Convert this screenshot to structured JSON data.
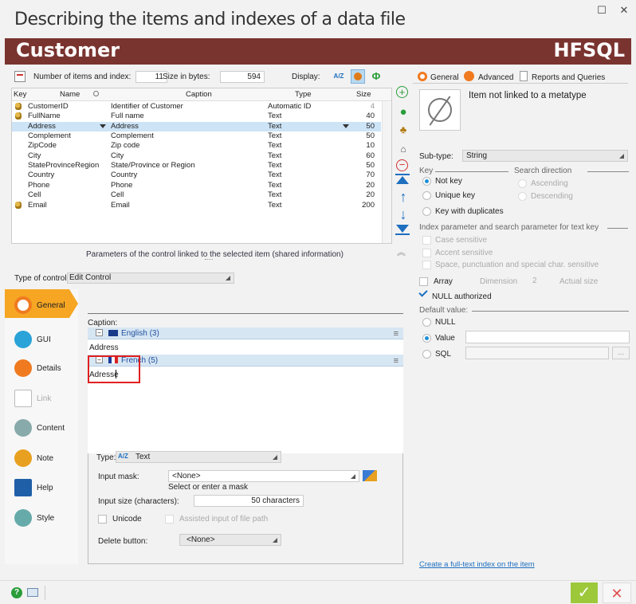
{
  "window": {
    "title": "Describing the items and indexes of a data file",
    "minimize": "☐",
    "close": "✕"
  },
  "banner": {
    "name": "Customer",
    "brand": "HFSQL"
  },
  "toolbar": {
    "items_label": "Number of items and index:",
    "items_value": "11",
    "size_label": "Size in bytes:",
    "size_value": "594",
    "display_label": "Display:",
    "az": "A/Z"
  },
  "grid": {
    "headers": {
      "key": "Key",
      "name": "Name",
      "caption": "Caption",
      "type": "Type",
      "size": "Size"
    },
    "rows": [
      {
        "key": "key",
        "name": "CustomerID",
        "caption": "Identifier of Customer",
        "type": "Automatic ID",
        "size": "4",
        "selected": false
      },
      {
        "key": "key",
        "name": "FullName",
        "caption": "Full name",
        "type": "Text",
        "size": "40",
        "selected": false
      },
      {
        "key": "",
        "name": "Address",
        "caption": "Address",
        "type": "Text",
        "size": "50",
        "selected": true
      },
      {
        "key": "",
        "name": "Complement",
        "caption": "Complement",
        "type": "Text",
        "size": "50",
        "selected": false
      },
      {
        "key": "",
        "name": "ZipCode",
        "caption": "Zip code",
        "type": "Text",
        "size": "10",
        "selected": false
      },
      {
        "key": "",
        "name": "City",
        "caption": "City",
        "type": "Text",
        "size": "60",
        "selected": false
      },
      {
        "key": "",
        "name": "StateProvinceRegion",
        "caption": "State/Province or Region",
        "type": "Text",
        "size": "50",
        "selected": false
      },
      {
        "key": "",
        "name": "Country",
        "caption": "Country",
        "type": "Text",
        "size": "70",
        "selected": false
      },
      {
        "key": "",
        "name": "Phone",
        "caption": "Phone",
        "type": "Text",
        "size": "20",
        "selected": false
      },
      {
        "key": "",
        "name": "Cell",
        "caption": "Cell",
        "type": "Text",
        "size": "20",
        "selected": false
      },
      {
        "key": "key",
        "name": "Email",
        "caption": "Email",
        "type": "Text",
        "size": "200",
        "selected": false
      }
    ]
  },
  "params_label": "Parameters of the control linked to the selected item (shared information)",
  "control_type": {
    "label": "Type of control",
    "value": "Edit Control"
  },
  "nav": [
    {
      "label": "General",
      "icon": "orange-circle-icon"
    },
    {
      "label": "GUI",
      "icon": "eye-icon"
    },
    {
      "label": "Details",
      "icon": "orange-circle-icon"
    },
    {
      "label": "Link",
      "icon": "link-icon"
    },
    {
      "label": "Content",
      "icon": "flask-icon"
    },
    {
      "label": "Note",
      "icon": "pencil-icon"
    },
    {
      "label": "Help",
      "icon": "help-icon"
    },
    {
      "label": "Style",
      "icon": "palette-icon"
    }
  ],
  "caption": {
    "label": "Caption:",
    "english": "English (3)",
    "english_value": "Address",
    "french": "French (5)",
    "french_value": "Adresse"
  },
  "typebox": {
    "type_label": "Type:",
    "type_value": "Text",
    "az": "A/Z",
    "mask_label": "Input mask:",
    "mask_value": "<None>",
    "mask_hint": "Select or enter a mask",
    "size_label": "Input size (characters):",
    "size_value": "50 characters",
    "unicode": "Unicode",
    "assisted": "Assisted input of file path",
    "delete_label": "Delete button:",
    "delete_value": "<None>"
  },
  "right": {
    "tabs": {
      "general": "General",
      "advanced": "Advanced",
      "reports": "Reports and Queries"
    },
    "metatype": "Item not linked to a metatype",
    "subtype_label": "Sub-type:",
    "subtype_value": "String",
    "key_head": "Key",
    "search_head": "Search direction",
    "not_key": "Not key",
    "unique_key": "Unique key",
    "dup_key": "Key with duplicates",
    "asc": "Ascending",
    "desc": "Descending",
    "index_head": "Index parameter and search parameter for text key",
    "case": "Case sensitive",
    "accent": "Accent sensitive",
    "space": "Space, punctuation and special char. sensitive",
    "array": "Array",
    "dimension": "Dimension",
    "dimension_value": "2",
    "actual_size": "Actual size",
    "null_auth": "NULL authorized",
    "default_head": "Default value:",
    "null": "NULL",
    "value": "Value",
    "sql": "SQL",
    "dots": "...",
    "fulltext": "Create a full-text index on the item"
  },
  "colors": {
    "banner": "#7a3430",
    "accent": "#f6a623",
    "ok": "#9dc83a",
    "cancel": "#e05050",
    "selection": "#cde4f7"
  }
}
